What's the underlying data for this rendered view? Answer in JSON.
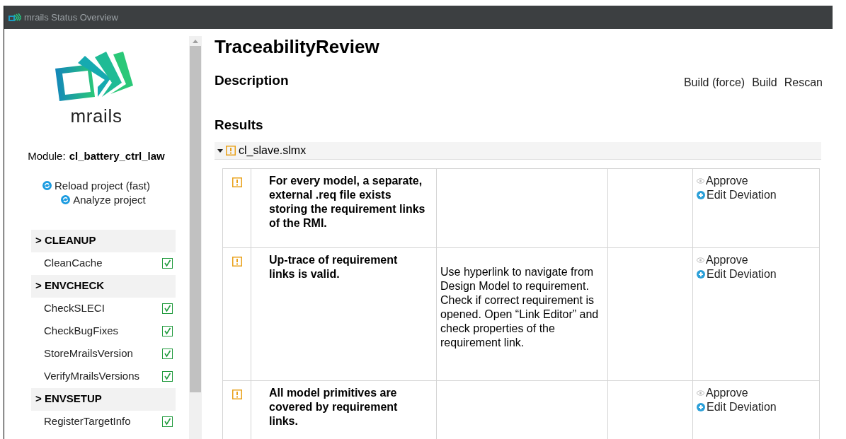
{
  "window": {
    "title": "mrails Status Overview"
  },
  "sidebar": {
    "logo_text": "mrails",
    "module_label": "Module:",
    "module_name": "cl_battery_ctrl_law",
    "actions": [
      "Reload project (fast)",
      "Analyze project"
    ],
    "groups": [
      {
        "label": "> CLEANUP",
        "items": [
          {
            "label": "CleanCache",
            "checked": true
          }
        ]
      },
      {
        "label": "> ENVCHECK",
        "items": [
          {
            "label": "CheckSLECI",
            "checked": true
          },
          {
            "label": "CheckBugFixes",
            "checked": true
          },
          {
            "label": "StoreMrailsVersion",
            "checked": true
          },
          {
            "label": "VerifyMrailsVersions",
            "checked": true
          }
        ]
      },
      {
        "label": "> ENVSETUP",
        "items": [
          {
            "label": "RegisterTargetInfo",
            "checked": true
          }
        ]
      }
    ]
  },
  "main": {
    "title": "TraceabilityReview",
    "description_heading": "Description",
    "buttons": [
      "Build (force)",
      "Build",
      "Rescan"
    ],
    "results_heading": "Results",
    "file": {
      "name": "cl_slave.slmx",
      "expanded": true,
      "warning": true
    },
    "rows": [
      {
        "warning": true,
        "check": "For every model, a separate, external .req file exists storing the requirement links of the RMI.",
        "hint": "",
        "actions": [
          "Approve",
          "Edit Deviation"
        ]
      },
      {
        "warning": true,
        "check": "Up-trace of requirement links is valid.",
        "hint": "Use hyperlink to navigate from Design Model to requirement. Check if correct requirement is opened. Open “Link Editor” and check properties of the requirement link.",
        "actions": [
          "Approve",
          "Edit Deviation"
        ]
      },
      {
        "warning": true,
        "check": "All model primitives are covered by requirement links.",
        "hint": "",
        "actions": [
          "Approve",
          "Edit Deviation"
        ]
      }
    ]
  }
}
